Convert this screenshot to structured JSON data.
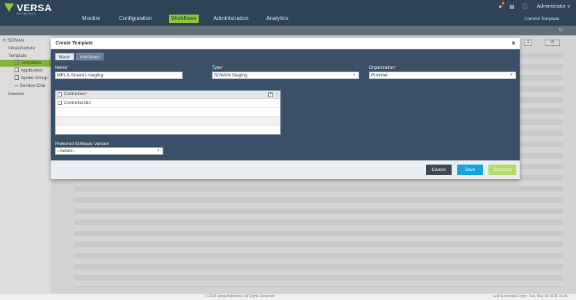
{
  "header": {
    "logo_text": "VERSA",
    "logo_sub": "NETWORKS",
    "nav": [
      "Monitor",
      "Configuration",
      "Workflows",
      "Administration",
      "Analytics"
    ],
    "active_nav": "Workflows",
    "notification_count": "4",
    "user": "Administrator",
    "user_chevron": "∨",
    "commit_label": "Commit Template",
    "icons": [
      "bell-icon",
      "document-icon",
      "info-icon",
      "refresh-icon"
    ],
    "accent_color": "#8dc63f"
  },
  "sidebar": {
    "root": "SDWAN",
    "items": [
      {
        "label": "Infrastructure"
      },
      {
        "label": "Template"
      },
      {
        "label": "Templates"
      },
      {
        "label": "Application"
      },
      {
        "label": "Spoke Group"
      },
      {
        "label": "Service Chai"
      },
      {
        "label": "Devices"
      }
    ],
    "selected": "Templates"
  },
  "background": {
    "pager_page": "1",
    "pager_size": "25"
  },
  "modal": {
    "title": "Create Template",
    "close_label": "×",
    "tabs": [
      {
        "label": "Basic",
        "active": true
      },
      {
        "label": "Interfaces",
        "active": false
      }
    ],
    "name": {
      "label": "Name",
      "required": "*",
      "value": "MPLS-Tenant1-staging"
    },
    "type": {
      "label": "Type",
      "required": "*",
      "value": "SDWAN Staging"
    },
    "organization": {
      "label": "Organization",
      "required": "*",
      "value": "Provider"
    },
    "controllers": {
      "header": "Controllers",
      "required": "*",
      "add_label": "+",
      "remove_label": "−",
      "rows": [
        "Controller182"
      ]
    },
    "software_version": {
      "label": "Preferred Software Version",
      "value": "--Select--"
    },
    "buttons": {
      "cancel": "Cancel",
      "save": "Save",
      "continue": "Continue"
    },
    "chevron": "∨"
  },
  "footer": {
    "copyright": "© 2018 Versa Networks | All Rights Reserved",
    "last_login": "Last Successful Login : Tue, May 08 2018, 15:46"
  }
}
